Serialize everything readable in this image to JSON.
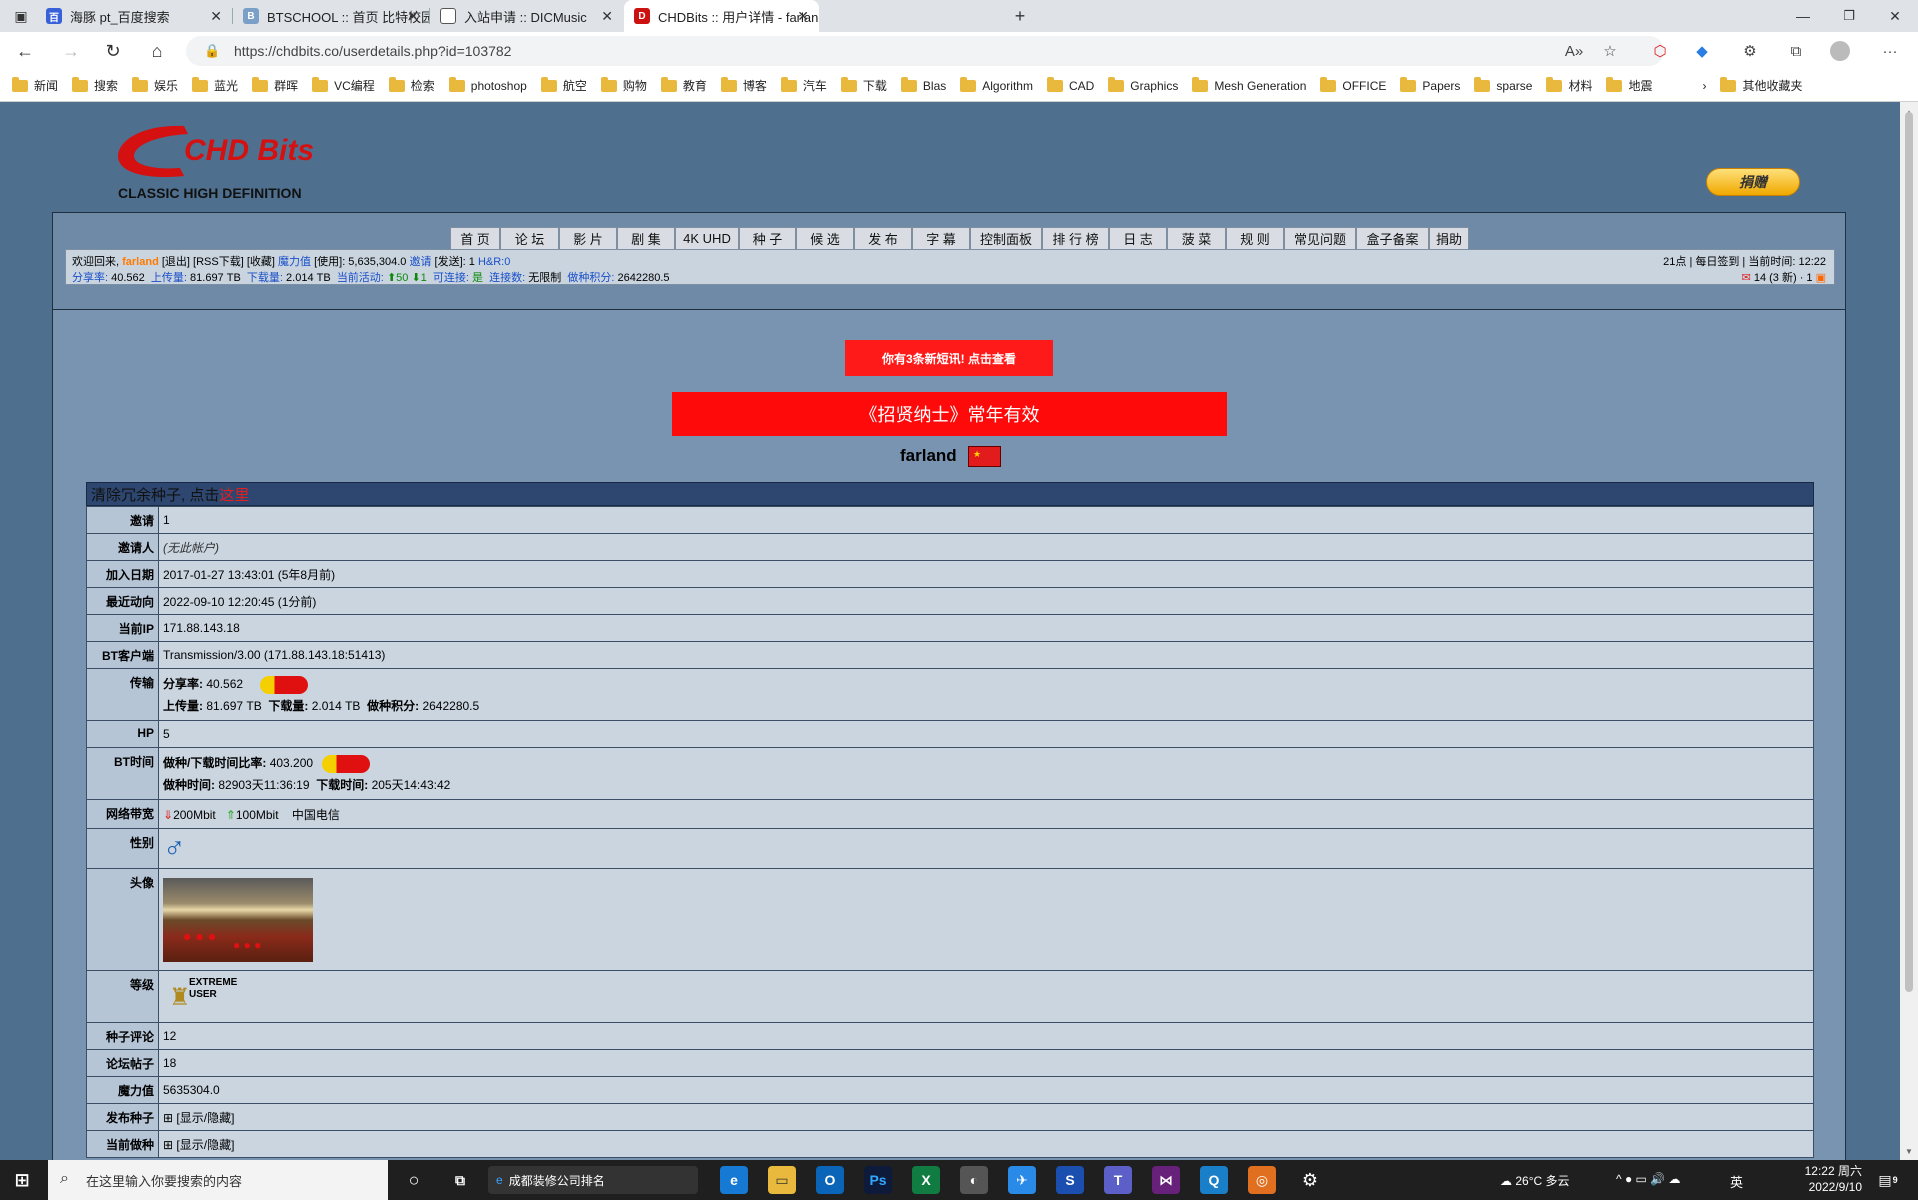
{
  "browser": {
    "tabs": [
      {
        "title": "海豚 pt_百度搜索",
        "icon": "baidu-icon",
        "color": "#3860d9"
      },
      {
        "title": "BTSCHOOL :: 首页 比特校园PT小",
        "icon": "btschool-icon",
        "color": "#7aa0c8"
      },
      {
        "title": "入站申请 :: DICMusic",
        "icon": "page-icon",
        "color": "#888888"
      },
      {
        "title": "CHDBits :: 用户详情 - farland - Po",
        "icon": "chdbits-icon",
        "color": "#cc1111"
      }
    ],
    "url": "https://chdbits.co/userdetails.php?id=103782",
    "bookmarks": [
      "新闻",
      "搜索",
      "娱乐",
      "蓝光",
      "群晖",
      "VC编程",
      "检索",
      "photoshop",
      "航空",
      "购物",
      "教育",
      "博客",
      "汽车",
      "下载",
      "Blas",
      "Algorithm",
      "CAD",
      "Graphics",
      "Mesh Generation",
      "OFFICE",
      "Papers",
      "sparse",
      "材料",
      "地震"
    ],
    "other_bookmarks": "其他收藏夹"
  },
  "site": {
    "logo_main": "CHD Bits",
    "logo_sub": "CLASSIC HIGH DEFINITION",
    "donate_label": "捐赠",
    "menu": [
      "首 页",
      "论 坛",
      "影 片",
      "剧 集",
      "4K UHD",
      "种 子",
      "候 选",
      "发 布",
      "字 幕",
      "控制面板",
      "排 行 榜",
      "日 志",
      "菠 菜",
      "规 则",
      "常见问题",
      "盒子备案",
      "捐助"
    ],
    "info": {
      "welcome": "欢迎回来,",
      "user": "farland",
      "links": "[退出] [RSS下载] [收藏]",
      "magic_label": "魔力值",
      "magic_value": "[使用]: 5,635,304.0",
      "invite_label": "邀请",
      "invite_value": "[发送]: 1",
      "hr_label": "H&R:0",
      "ratio_label": "分享率:",
      "ratio_value": "40.562",
      "up_label": "上传量:",
      "up_value": "81.697 TB",
      "down_label": "下载量:",
      "down_value": "2.014 TB",
      "active_label": "当前活动:",
      "active_value": "⬆50 ⬇1",
      "connect_label": "可连接:",
      "connect_value": "是",
      "conn_label": "连接数:",
      "conn_value": "无限制",
      "seed_label": "做种积分:",
      "seed_value": "2642280.5",
      "right1": "21点 | 每日签到 | 当前时间: 12:22",
      "right2": "14 (3 新) · 1"
    },
    "message_box": "你有3条新短讯! 点击查看",
    "banner": "《招贤纳士》常年有效",
    "username": "farland"
  },
  "details": {
    "header_prefix": "清除冗余种子, 点击",
    "header_link": "这里",
    "rows": {
      "invite": {
        "k": "邀请",
        "v": "1"
      },
      "inviter": {
        "k": "邀请人",
        "v": "(无此帐户)"
      },
      "joined": {
        "k": "加入日期",
        "v": "2017-01-27 13:43:01 (5年8月前)"
      },
      "last": {
        "k": "最近动向",
        "v": "2022-09-10 12:20:45 (1分前)"
      },
      "ip": {
        "k": "当前IP",
        "v": "171.88.143.18"
      },
      "client": {
        "k": "BT客户端",
        "v": "Transmission/3.00 (171.88.143.18:51413)"
      },
      "transfer": {
        "k": "传输",
        "ratio": "分享率:",
        "ratio_v": "40.562",
        "up": "上传量:",
        "up_v": "81.697 TB",
        "down": "下载量:",
        "down_v": "2.014 TB",
        "seed": "做种积分:",
        "seed_v": "2642280.5"
      },
      "hp": {
        "k": "HP",
        "v": "5"
      },
      "bttime": {
        "k": "BT时间",
        "ratio": "做种/下载时间比率:",
        "ratio_v": "403.200",
        "seed": "做种时间:",
        "seed_v": "82903天11:36:19",
        "down": "下载时间:",
        "down_v": "205天14:43:42"
      },
      "bandwidth": {
        "k": "网络带宽",
        "down": "200Mbit",
        "up": "100Mbit",
        "isp": "中国电信"
      },
      "gender": {
        "k": "性别"
      },
      "avatar": {
        "k": "头像"
      },
      "class": {
        "k": "等级",
        "v1": "EXTREME",
        "v2": "USER"
      },
      "comments": {
        "k": "种子评论",
        "v": "12"
      },
      "posts": {
        "k": "论坛帖子",
        "v": "18"
      },
      "bonus": {
        "k": "魔力值",
        "v": "5635304.0"
      },
      "uploaded": {
        "k": "发布种子",
        "v": "[显示/隐藏]"
      },
      "seeding": {
        "k": "当前做种",
        "v": "[显示/隐藏]"
      }
    }
  },
  "taskbar": {
    "search_placeholder": "在这里输入你要搜索的内容",
    "edge_search": "成都装修公司排名",
    "weather": "26°C 多云",
    "ime": "英",
    "time": "12:22 周六",
    "date": "2022/9/10",
    "notif": "9"
  }
}
